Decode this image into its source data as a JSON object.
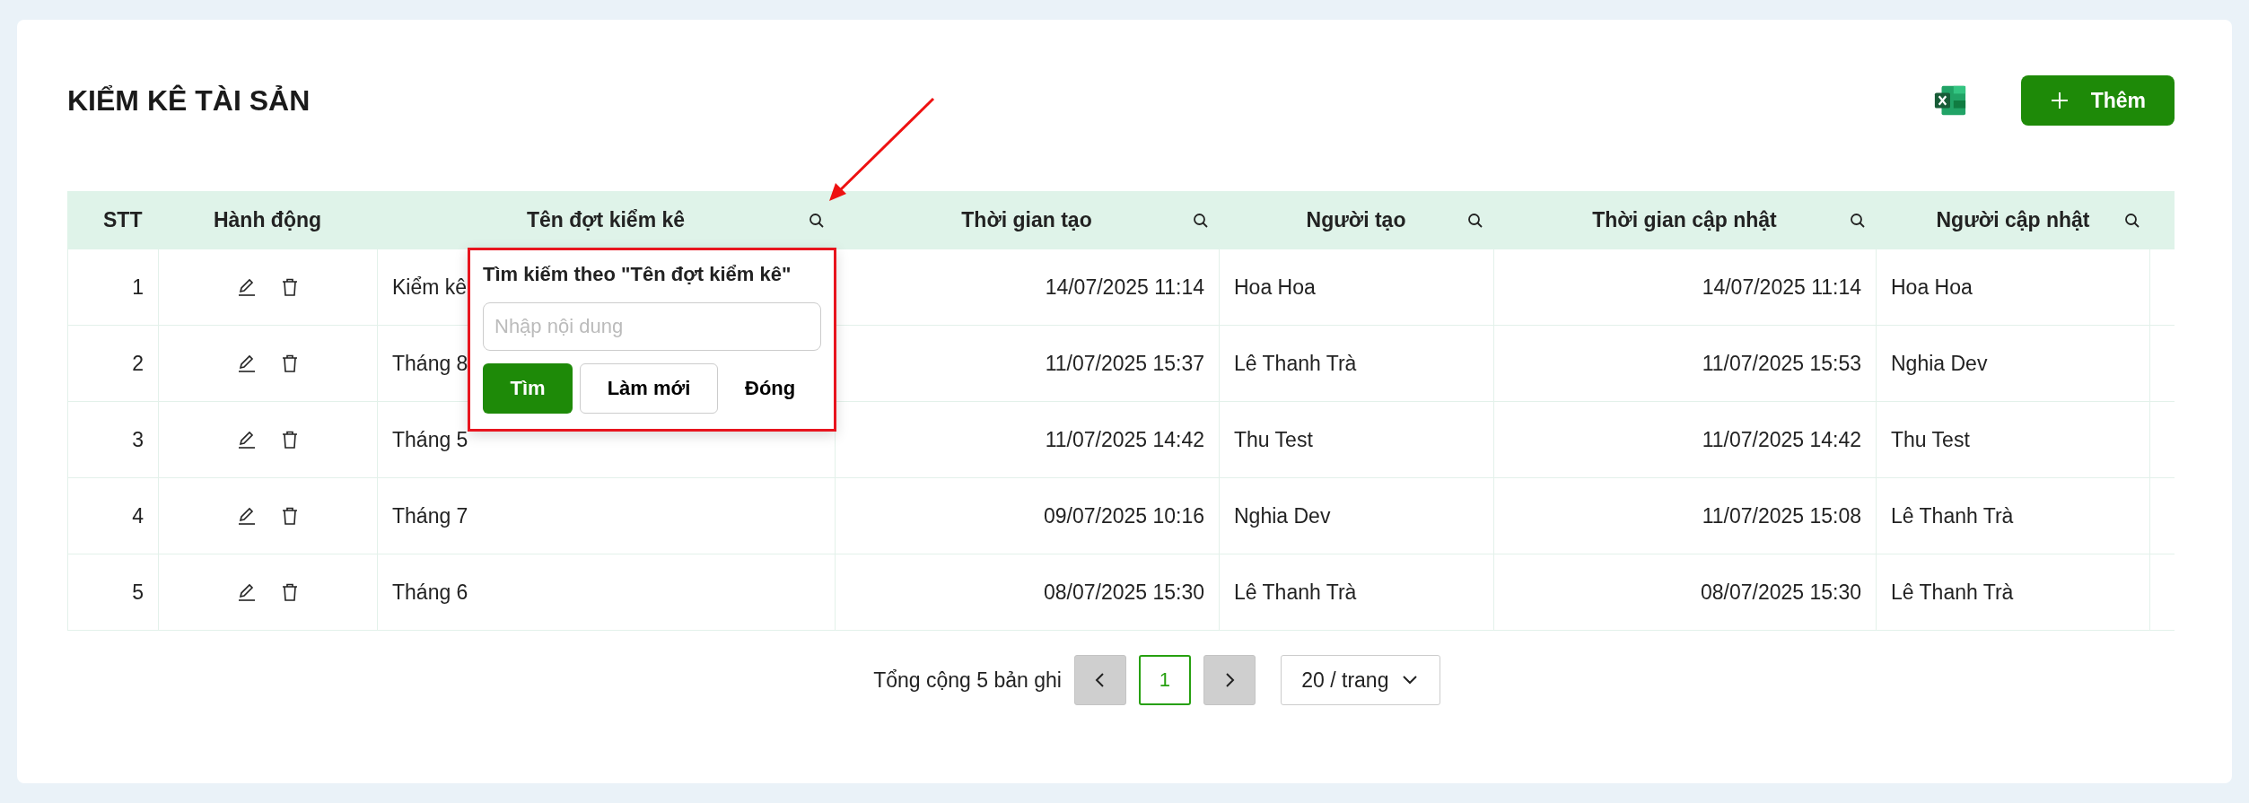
{
  "page": {
    "title": "KIỂM KÊ TÀI SẢN"
  },
  "toolbar": {
    "add_button": {
      "label": "Thêm"
    }
  },
  "table": {
    "columns": [
      {
        "label": "STT",
        "searchable": false
      },
      {
        "label": "Hành động",
        "searchable": false
      },
      {
        "label": "Tên đợt kiểm kê",
        "searchable": true
      },
      {
        "label": "Thời gian tạo",
        "searchable": true
      },
      {
        "label": "Người tạo",
        "searchable": true
      },
      {
        "label": "Thời gian cập nhật",
        "searchable": true
      },
      {
        "label": "Người cập nhật",
        "searchable": true
      }
    ],
    "rows": [
      {
        "stt": "1",
        "name": "Kiểm kê",
        "created_at": "14/07/2025 11:14",
        "creator": "Hoa Hoa",
        "updated_at": "14/07/2025 11:14",
        "updater": "Hoa Hoa"
      },
      {
        "stt": "2",
        "name": "Tháng 8",
        "created_at": "11/07/2025 15:37",
        "creator": "Lê Thanh Trà",
        "updated_at": "11/07/2025 15:53",
        "updater": "Nghia Dev"
      },
      {
        "stt": "3",
        "name": "Tháng 5",
        "created_at": "11/07/2025 14:42",
        "creator": "Thu Test",
        "updated_at": "11/07/2025 14:42",
        "updater": "Thu Test"
      },
      {
        "stt": "4",
        "name": "Tháng 7",
        "created_at": "09/07/2025 10:16",
        "creator": "Nghia Dev",
        "updated_at": "11/07/2025 15:08",
        "updater": "Lê Thanh Trà"
      },
      {
        "stt": "5",
        "name": "Tháng 6",
        "created_at": "08/07/2025 15:30",
        "creator": "Lê Thanh Trà",
        "updated_at": "08/07/2025 15:30",
        "updater": "Lê Thanh Trà"
      }
    ]
  },
  "search_popup": {
    "title": "Tìm kiếm theo \"Tên đợt kiểm kê\"",
    "placeholder": "Nhập nội dung",
    "buttons": [
      {
        "label": "Tìm",
        "kind": "primary"
      },
      {
        "label": "Làm mới",
        "kind": "outline"
      },
      {
        "label": "Đóng",
        "kind": "text"
      }
    ]
  },
  "pagination": {
    "total": "Tổng cộng 5 bản ghi",
    "prev_disabled": true,
    "next_disabled": true,
    "pages": [
      {
        "label": "1",
        "selected": true
      }
    ],
    "page_size": "20 / trang"
  }
}
